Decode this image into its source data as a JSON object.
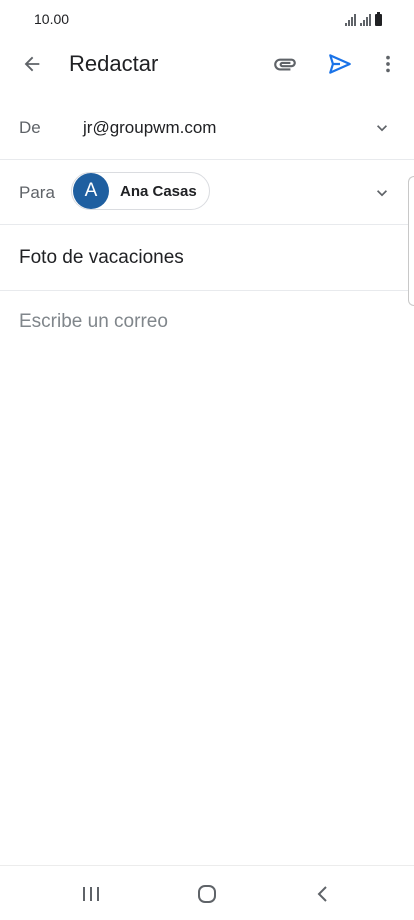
{
  "status_bar": {
    "time": "10.00"
  },
  "app_bar": {
    "title": "Redactar",
    "icons": {
      "back": "arrow-back-icon",
      "attach": "paperclip-icon",
      "send": "send-icon",
      "more": "more-vert-icon"
    }
  },
  "compose": {
    "from_label": "De",
    "from_value": "jr@groupwm.com",
    "to_label": "Para",
    "recipient": {
      "initial": "A",
      "name": "Ana Casas"
    },
    "subject": "Foto de vacaciones",
    "body_placeholder": "Escribe un correo"
  },
  "colors": {
    "accent": "#1a73e8",
    "avatar": "#1f5fa0",
    "icon": "#5f6368"
  }
}
